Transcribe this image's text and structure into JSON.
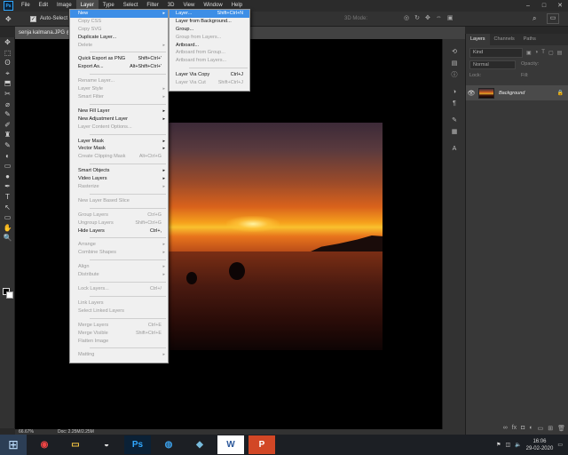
{
  "app": {
    "logo": "Ps"
  },
  "menubar": [
    "File",
    "Edit",
    "Image",
    "Layer",
    "Type",
    "Select",
    "Filter",
    "3D",
    "View",
    "Window",
    "Help"
  ],
  "window_controls": [
    "–",
    "□",
    "✕"
  ],
  "options": {
    "auto_select": "Auto-Select",
    "mode_3d": "3D Mode:"
  },
  "document": {
    "tab": "senja kalmana.JPG @",
    "zoom": "66.67%",
    "doc_size": "Doc: 2.25M/2.25M"
  },
  "tools": [
    "✥",
    "⬚",
    "ʘ",
    "⌖",
    "⬒",
    "✂",
    "⌀",
    "✎",
    "✐",
    "♜",
    "✎",
    "◐",
    "▭",
    "●",
    "✒",
    "T",
    "↖",
    "▭",
    "✋",
    "🔍"
  ],
  "layers_panel": {
    "tabs": [
      "Layers",
      "Channels",
      "Paths"
    ],
    "kind": "Kind",
    "blend": "Normal",
    "opacity": "Opacity:",
    "lock": "Lock:",
    "fill": "Fill:",
    "layer_name": "Background"
  },
  "layer_menu": [
    {
      "label": "New",
      "arrow": "▸",
      "state": "hl"
    },
    {
      "label": "Copy CSS",
      "state": "dis"
    },
    {
      "label": "Copy SVG",
      "state": "dis"
    },
    {
      "label": "Duplicate Layer..."
    },
    {
      "label": "Delete",
      "arrow": "▸",
      "state": "dis"
    },
    {
      "sep": true
    },
    {
      "label": "Quick Export as PNG",
      "shortcut": "Shift+Ctrl+'"
    },
    {
      "label": "Export As...",
      "shortcut": "Alt+Shift+Ctrl+'"
    },
    {
      "sep": true
    },
    {
      "label": "Rename Layer...",
      "state": "dis"
    },
    {
      "label": "Layer Style",
      "arrow": "▸",
      "state": "dis"
    },
    {
      "label": "Smart Filter",
      "arrow": "▸",
      "state": "dis"
    },
    {
      "sep": true
    },
    {
      "label": "New Fill Layer",
      "arrow": "▸"
    },
    {
      "label": "New Adjustment Layer",
      "arrow": "▸"
    },
    {
      "label": "Layer Content Options...",
      "state": "dis"
    },
    {
      "sep": true
    },
    {
      "label": "Layer Mask",
      "arrow": "▸"
    },
    {
      "label": "Vector Mask",
      "arrow": "▸"
    },
    {
      "label": "Create Clipping Mask",
      "shortcut": "Alt+Ctrl+G",
      "state": "dis"
    },
    {
      "sep": true
    },
    {
      "label": "Smart Objects",
      "arrow": "▸"
    },
    {
      "label": "Video Layers",
      "arrow": "▸"
    },
    {
      "label": "Rasterize",
      "arrow": "▸",
      "state": "dis"
    },
    {
      "sep": true
    },
    {
      "label": "New Layer Based Slice",
      "state": "dis"
    },
    {
      "sep": true
    },
    {
      "label": "Group Layers",
      "shortcut": "Ctrl+G",
      "state": "dis"
    },
    {
      "label": "Ungroup Layers",
      "shortcut": "Shift+Ctrl+G",
      "state": "dis"
    },
    {
      "label": "Hide Layers",
      "shortcut": "Ctrl+,"
    },
    {
      "sep": true
    },
    {
      "label": "Arrange",
      "arrow": "▸",
      "state": "dis"
    },
    {
      "label": "Combine Shapes",
      "arrow": "▸",
      "state": "dis"
    },
    {
      "sep": true
    },
    {
      "label": "Align",
      "arrow": "▸",
      "state": "dis"
    },
    {
      "label": "Distribute",
      "arrow": "▸",
      "state": "dis"
    },
    {
      "sep": true
    },
    {
      "label": "Lock Layers...",
      "shortcut": "Ctrl+/",
      "state": "dis"
    },
    {
      "sep": true
    },
    {
      "label": "Link Layers",
      "state": "dis"
    },
    {
      "label": "Select Linked Layers",
      "state": "dis"
    },
    {
      "sep": true
    },
    {
      "label": "Merge Layers",
      "shortcut": "Ctrl+E",
      "state": "dis"
    },
    {
      "label": "Merge Visible",
      "shortcut": "Shift+Ctrl+E",
      "state": "dis"
    },
    {
      "label": "Flatten Image",
      "state": "dis"
    },
    {
      "sep": true
    },
    {
      "label": "Matting",
      "arrow": "▸",
      "state": "dis"
    }
  ],
  "new_submenu": [
    {
      "label": "Layer...",
      "shortcut": "Shift+Ctrl+N",
      "state": "hl"
    },
    {
      "label": "Layer from Background..."
    },
    {
      "label": "Group..."
    },
    {
      "label": "Group from Layers...",
      "state": "dis"
    },
    {
      "label": "Artboard..."
    },
    {
      "label": "Artboard from Group...",
      "state": "dis"
    },
    {
      "label": "Artboard from Layers...",
      "state": "dis"
    },
    {
      "sep": true
    },
    {
      "label": "Layer Via Copy",
      "shortcut": "Ctrl+J"
    },
    {
      "label": "Layer Via Cut",
      "shortcut": "Shift+Ctrl+J",
      "state": "dis"
    }
  ],
  "taskbar": {
    "apps": [
      "Chrome",
      "Explorer",
      "Inkscape",
      "Ps",
      "Edge",
      "Notes",
      "W",
      "P"
    ],
    "time": "16:06",
    "date": "29-02-2020"
  }
}
